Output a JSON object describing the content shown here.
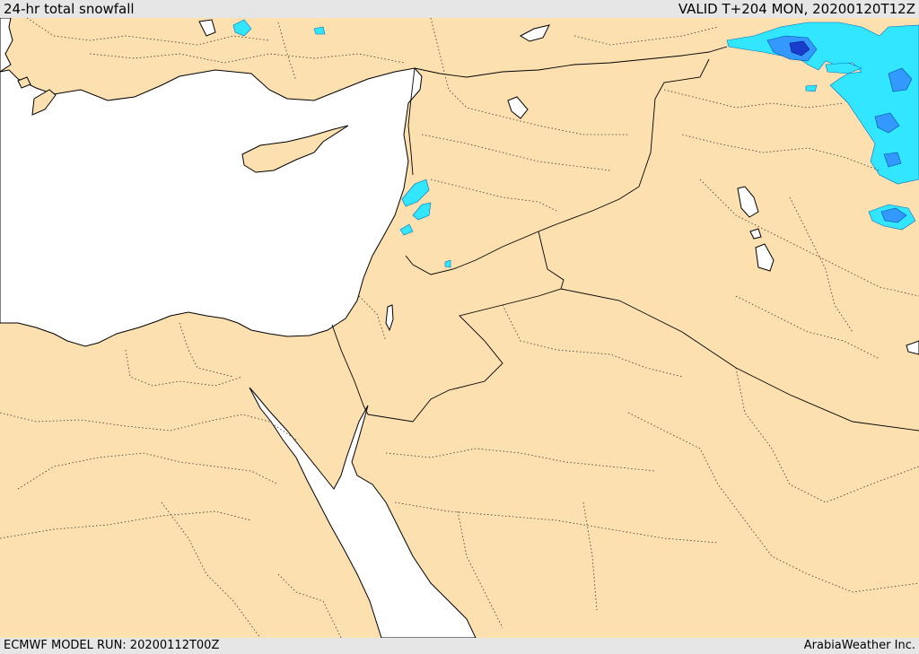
{
  "header": {
    "title": "24-hr total snowfall",
    "valid": "VALID T+204 MON, 20200120T12Z"
  },
  "footer": {
    "model_run": "ECMWF MODEL RUN: 20200112T00Z",
    "credit": "ArabiaWeather Inc."
  },
  "map": {
    "colors": {
      "land": "#fde0b0",
      "sea": "#ffffff",
      "border": "#000000",
      "snow_light": "#33e6ff",
      "snow_medium": "#3399ff",
      "snow_heavy": "#1a3ccc"
    }
  }
}
